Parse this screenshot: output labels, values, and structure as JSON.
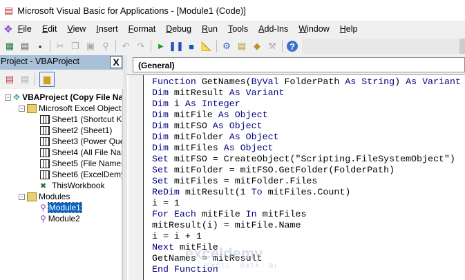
{
  "window": {
    "title": "Microsoft Visual Basic for Applications - [Module1 (Code)]"
  },
  "menu": [
    "File",
    "Edit",
    "View",
    "Insert",
    "Format",
    "Debug",
    "Run",
    "Tools",
    "Add-Ins",
    "Window",
    "Help"
  ],
  "toolbar": [
    "excel-icon",
    "insert-userform-icon",
    "save-icon",
    "cut-icon",
    "copy-icon",
    "paste-icon",
    "find-icon",
    "undo-icon",
    "redo-icon",
    "run-icon",
    "break-icon",
    "reset-icon",
    "design-mode-icon",
    "project-explorer-icon",
    "properties-icon",
    "object-browser-icon",
    "toolbox-icon",
    "help-icon"
  ],
  "project": {
    "title": "Project - VBAProject",
    "close": "X",
    "root": "VBAProject (Copy File Na",
    "excel_objects": "Microsoft Excel Objects",
    "sheets": [
      "Sheet1 (Shortcut Ke",
      "Sheet2 (Sheet1)",
      "Sheet3 (Power Quer",
      "Sheet4 (All File Nam",
      "Sheet5 (File Names",
      "Sheet6 (ExcelDemy)",
      "ThisWorkbook"
    ],
    "modules_folder": "Modules",
    "modules": [
      "Module1",
      "Module2"
    ],
    "selected": "Module1"
  },
  "code": {
    "object_dropdown": "(General)",
    "lines": [
      [
        [
          "kw",
          "Function "
        ],
        [
          "id",
          "GetNames("
        ],
        [
          "kw",
          "ByVal "
        ],
        [
          "id",
          "FolderPath "
        ],
        [
          "kw",
          "As String"
        ],
        [
          "id",
          ") "
        ],
        [
          "kw",
          "As Variant"
        ]
      ],
      [
        [
          "kw",
          "Dim "
        ],
        [
          "id",
          "mitResult "
        ],
        [
          "kw",
          "As Variant"
        ]
      ],
      [
        [
          "kw",
          "Dim "
        ],
        [
          "id",
          "i "
        ],
        [
          "kw",
          "As Integer"
        ]
      ],
      [
        [
          "kw",
          "Dim "
        ],
        [
          "id",
          "mitFile "
        ],
        [
          "kw",
          "As Object"
        ]
      ],
      [
        [
          "kw",
          "Dim "
        ],
        [
          "id",
          "mitFSO "
        ],
        [
          "kw",
          "As Object"
        ]
      ],
      [
        [
          "kw",
          "Dim "
        ],
        [
          "id",
          "mitFolder "
        ],
        [
          "kw",
          "As Object"
        ]
      ],
      [
        [
          "kw",
          "Dim "
        ],
        [
          "id",
          "mitFiles "
        ],
        [
          "kw",
          "As Object"
        ]
      ],
      [
        [
          "kw",
          "Set "
        ],
        [
          "id",
          "mitFSO = CreateObject(\"Scripting.FileSystemObject\")"
        ]
      ],
      [
        [
          "kw",
          "Set "
        ],
        [
          "id",
          "mitFolder = mitFSO.GetFolder(FolderPath)"
        ]
      ],
      [
        [
          "kw",
          "Set "
        ],
        [
          "id",
          "mitFiles = mitFolder.Files"
        ]
      ],
      [
        [
          "kw",
          "ReDim "
        ],
        [
          "id",
          "mitResult(1 "
        ],
        [
          "kw",
          "To "
        ],
        [
          "id",
          "mitFiles.Count)"
        ]
      ],
      [
        [
          "id",
          "i = 1"
        ]
      ],
      [
        [
          "kw",
          "For Each "
        ],
        [
          "id",
          "mitFile "
        ],
        [
          "kw",
          "In "
        ],
        [
          "id",
          "mitFiles"
        ]
      ],
      [
        [
          "id",
          "mitResult(i) = mitFile.Name"
        ]
      ],
      [
        [
          "id",
          "i = i + 1"
        ]
      ],
      [
        [
          "kw",
          "Next "
        ],
        [
          "id",
          "mitFile"
        ]
      ],
      [
        [
          "id",
          "GetNames = mitResult"
        ]
      ],
      [
        [
          "kw",
          "End Function"
        ]
      ]
    ]
  },
  "watermark": {
    "brand": "exceldemy",
    "tagline": "EXCEL · DATA · BI"
  }
}
